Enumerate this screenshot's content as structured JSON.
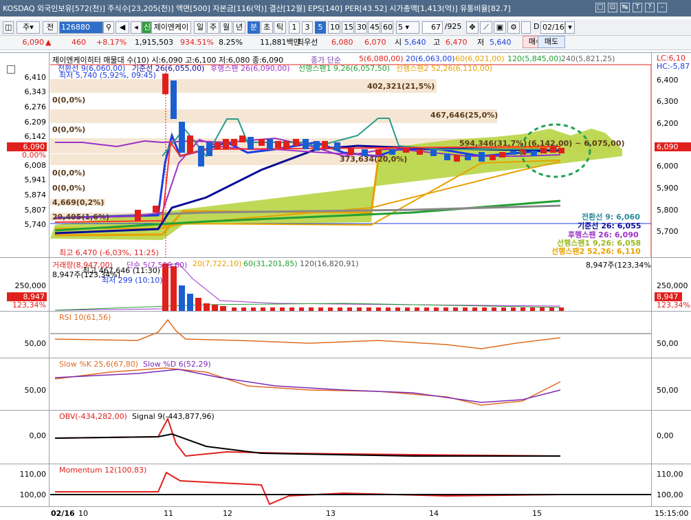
{
  "topbar": {
    "text": "KOSDAQ 외국인보유[572(천)] 주식수[23,205(천)] 액면[500] 자본금[116(억)] 결산[12월] EPS[140] PER[43.52] 시가총액[1,413(억)] 유통비율[82.7]",
    "win_buttons": [
      "□",
      "⊡",
      "↹",
      "T",
      "?",
      "-"
    ]
  },
  "toolbar": {
    "period_select": "주",
    "code_label": "전",
    "code_input": "126880",
    "stock_name": "제이엔케이",
    "intervals": [
      "일",
      "주",
      "월",
      "년",
      "분",
      "초",
      "틱"
    ],
    "minutes": [
      "1",
      "3",
      "5",
      "10",
      "15",
      "30",
      "45",
      "60"
    ],
    "active_minute": "5",
    "count_select": "5",
    "count_value": "67",
    "count_total": "/925",
    "date": "02/16"
  },
  "pricebar": {
    "price": "6,090",
    "change": "460",
    "change_pct": "+8.17%",
    "volume": "1,915,503",
    "vol_ratio": "934.51%",
    "turnover": "8.25%",
    "amount": "11,881백만",
    "best_label": "최우선",
    "best_ask": "6,080",
    "best_bid": "6,070",
    "open_label": "시",
    "open": "5,640",
    "high_label": "고",
    "high": "6,470",
    "low_label": "저",
    "low": "5,640",
    "buy_btn": "매수",
    "sell_btn": "매도"
  },
  "price_panel": {
    "title": "제이엔케이히터 매물대 수(10)  시:6,090 고:6,100 저:6,080 종:6,090",
    "ma_legend": {
      "label": "종가 단순",
      "ma5": "5(6,080,00)",
      "ma20": "20(6,063,00)",
      "ma60": "60(6,021,00)",
      "ma120": "120(5,845,00)",
      "ma240": "240(5,821,25)"
    },
    "ichimoku_legend": {
      "tenkan": "전환선 9(6,060,00)",
      "kijun": "기준선 26(6,055,00)",
      "chikou": "후행스팬 26(6,090,00)",
      "span1": "선행스팬1 9,26(6,057,50)",
      "span2": "선행스팬2 52,26(6,110,00)"
    },
    "lc": "LC:6,10",
    "hc": "HC:-5,87",
    "low_note": "최저 5,740 (5,92%, 09:45)",
    "high_note": "최고 6,470 (-6,03%, 11:25)",
    "current_tag": "6,090",
    "current_pct": "0,00%",
    "yticks": [
      "6,410",
      "6,343",
      "6,276",
      "6,209",
      "6,142",
      "6,075",
      "6,008",
      "5,941",
      "5,874",
      "5,807",
      "5,740"
    ],
    "ryticks": [
      "6,400",
      "6,300",
      "6,200",
      "6,100",
      "6,000",
      "5,900",
      "5,800",
      "5,700"
    ],
    "rtag": "6,090",
    "volume_profile": [
      "402,321(21,5%)",
      "467,646(25,0%)",
      "594,346(31,7%)",
      "373,634(20,0%)",
      "4,669(0,2%)",
      "29,495(1,6%)"
    ],
    "zero_profiles": [
      "0(0,0%)",
      "0(0,0%)",
      "0(0,0%)",
      "0(0,0%)",
      "0(0,0%)"
    ],
    "cloud_note": "(6,142,00) ~ 6,075,00)",
    "right_legend": [
      "전환선 9: 6,060",
      "기준선 26: 6,055",
      "후행스팬 26: 6,090",
      "선행스팬1 9,26: 6,058",
      "선행스팬2 52,26: 6,110"
    ]
  },
  "volume_panel": {
    "title": "거래량(8,947,00)",
    "ma_label": "단순 5(7,519,60)",
    "ma20": "20(7,722,10)",
    "ma60": "60(31,201,85)",
    "ma120": "120(16,820,91)",
    "right_label": "8,947주(123,34%)",
    "max_note": "최고 467,646 (11:30)",
    "min_note": "최저 299 (10:10)",
    "cur_note": "8,947주(123,34%)",
    "ytick": "250,000",
    "tag": "8,947",
    "tag_pct": "123,34%"
  },
  "rsi_panel": {
    "title": "RSI 10(61,56)",
    "ytick": "50,00"
  },
  "stoch_panel": {
    "title_k": "Slow %K 25,6(67,80)",
    "title_d": "Slow %D 6(52,29)",
    "ytick": "50,00"
  },
  "obv_panel": {
    "title_obv": "OBV(-434,282,00)",
    "title_sig": "Signal 9(-443,877,96)",
    "ytick": "0,00"
  },
  "mom_panel": {
    "title": "Momentum 12(100,83)",
    "ytick1": "110,00",
    "ytick2": "100,00"
  },
  "xaxis": {
    "date": "02/16",
    "labels": [
      "10",
      "11",
      "12",
      "13",
      "14",
      "15"
    ],
    "time": "15:15:00"
  },
  "colors": {
    "up": "#e0201c",
    "down": "#1a5fd0",
    "tenkan": "#1a3ce0",
    "kijun": "#0a0a96",
    "chikou": "#9b30c8",
    "span1": "#22a032",
    "span2": "#e8a000",
    "cloud": "#9ac81e",
    "rsi": "#e06a20"
  }
}
